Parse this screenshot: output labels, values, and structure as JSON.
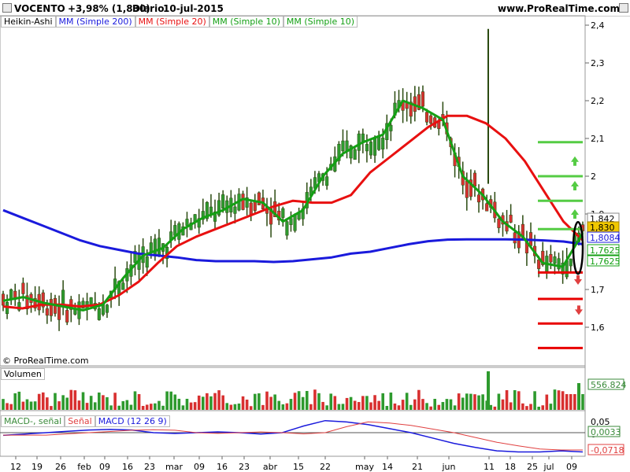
{
  "header": {
    "ticker": "VOCENTO",
    "change": "+3,98% (1,830)",
    "period": "Diario",
    "date": "10-jul-2015",
    "site": "www.ProRealTime.com"
  },
  "legend": {
    "heikin": "Heikin-Ashi",
    "ma200": "MM (Simple 200)",
    "ma20": "MM (Simple 20)",
    "ma10a": "MM (Simple 10)",
    "ma10b": "MM (Simple 10)"
  },
  "copyright": "© ProRealTime.com",
  "volume_label": "Volumen",
  "macd_labels": {
    "a": "MACD-, señal",
    "b": "Señal",
    "c": "MACD (12 26 9)"
  },
  "colors": {
    "ma200": "#1a1adc",
    "ma20": "#e81010",
    "ma10": "#14a014",
    "bull": "#2e9a2e",
    "bear": "#d83030",
    "wick": "#2a4a10",
    "support": "#e80000",
    "resistance": "#55cc44",
    "vol_up": "#2e9a2e",
    "vol_down": "#d83030"
  },
  "icons": [
    "up-arrow-icon",
    "down-arrow-icon",
    "highlight-ellipse-icon"
  ],
  "chart_data": [
    {
      "type": "candlestick",
      "title": "VOCENTO",
      "ylim": [
        1.53,
        2.42
      ],
      "yticks": [
        "2,4",
        "2,3",
        "2,2",
        "2,1",
        "2",
        "1,9",
        "1,7",
        "1,6"
      ],
      "xticks": [
        "12",
        "19",
        "26",
        "feb",
        "09",
        "16",
        "23",
        "mar",
        "09",
        "16",
        "23",
        "abr",
        "15",
        "22",
        "may",
        "14",
        "21",
        "jun",
        "11",
        "18",
        "25",
        "jul",
        "09"
      ],
      "price_labels": [
        {
          "text": "1,842",
          "value": 1.842,
          "kind": "plain"
        },
        {
          "text": "1,830",
          "value": 1.83,
          "kind": "last"
        },
        {
          "text": "1,8084",
          "value": 1.8084,
          "kind": "ma200"
        },
        {
          "text": "1,7625",
          "value": 1.7625,
          "kind": "ma10"
        },
        {
          "text": "1,7625",
          "value": 1.7625,
          "kind": "ma10b"
        }
      ],
      "ma200": [
        1.91,
        1.89,
        1.87,
        1.85,
        1.83,
        1.815,
        1.805,
        1.795,
        1.79,
        1.785,
        1.778,
        1.775,
        1.775,
        1.775,
        1.773,
        1.775,
        1.78,
        1.785,
        1.795,
        1.8,
        1.81,
        1.82,
        1.828,
        1.832,
        1.833,
        1.833,
        1.833,
        1.832,
        1.83,
        1.827,
        1.82
      ],
      "ma20": [
        1.655,
        1.65,
        1.66,
        1.66,
        1.655,
        1.66,
        1.685,
        1.72,
        1.77,
        1.815,
        1.84,
        1.86,
        1.88,
        1.9,
        1.92,
        1.935,
        1.93,
        1.93,
        1.95,
        2.01,
        2.05,
        2.09,
        2.13,
        2.16,
        2.16,
        2.14,
        2.1,
        2.04,
        1.96,
        1.88,
        1.83
      ],
      "ma10": [
        1.67,
        1.68,
        1.665,
        1.655,
        1.645,
        1.66,
        1.73,
        1.79,
        1.81,
        1.86,
        1.89,
        1.91,
        1.94,
        1.93,
        1.88,
        1.91,
        2.0,
        2.06,
        2.09,
        2.11,
        2.2,
        2.18,
        2.15,
        2.0,
        1.95,
        1.88,
        1.84,
        1.77,
        1.76,
        1.85
      ],
      "support_levels": [
        1.745,
        1.675,
        1.61,
        1.545
      ],
      "resistance_levels": [
        2.09,
        2.0,
        1.935,
        1.86
      ]
    },
    {
      "type": "bar",
      "title": "Volumen",
      "last_value": "556.824"
    },
    {
      "type": "line",
      "title": "MACD (12 26 9)",
      "yticks": [
        "0,05",
        "0"
      ],
      "values": {
        "macd_minus_signal": "0,0033",
        "macd": "-0,0718"
      }
    }
  ]
}
